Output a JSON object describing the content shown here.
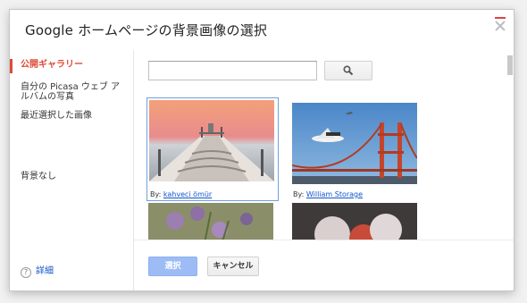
{
  "dialog": {
    "title": "Google ホームページの背景画像の選択"
  },
  "sidebar": {
    "items": [
      {
        "label": "公開ギャラリー",
        "selected": true
      },
      {
        "label": "自分の Picasa ウェブ アルバムの写真",
        "selected": false
      },
      {
        "label": "最近選択した画像",
        "selected": false
      },
      {
        "label": "背景なし",
        "selected": false
      }
    ],
    "help_label": "詳細"
  },
  "search": {
    "value": "",
    "button_icon": "search-icon"
  },
  "gallery": {
    "items": [
      {
        "by": "By:",
        "author": "kahveci ömür",
        "selected": true
      },
      {
        "by": "By:",
        "author": "William Storage",
        "selected": false
      },
      {
        "by": "",
        "author": "",
        "selected": false
      },
      {
        "by": "",
        "author": "",
        "selected": false
      }
    ]
  },
  "footer": {
    "select_label": "選択",
    "cancel_label": "キャンセル"
  },
  "colors": {
    "accent": "#dd4b39",
    "link": "#1155cc",
    "primary_button_disabled": "#9dbcf6"
  }
}
